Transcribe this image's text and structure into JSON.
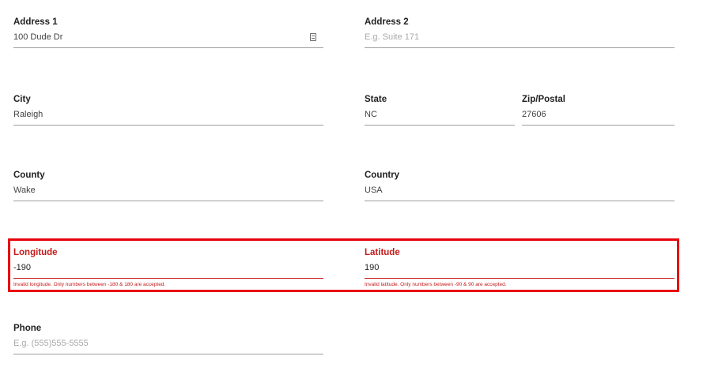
{
  "address1": {
    "label": "Address 1",
    "value": "100 Dude Dr",
    "icon": "contact-card-icon"
  },
  "address2": {
    "label": "Address 2",
    "placeholder": "E.g. Suite 171"
  },
  "city": {
    "label": "City",
    "value": "Raleigh"
  },
  "state": {
    "label": "State",
    "value": "NC"
  },
  "zip": {
    "label": "Zip/Postal",
    "value": "27606"
  },
  "county": {
    "label": "County",
    "value": "Wake"
  },
  "country": {
    "label": "Country",
    "value": "USA"
  },
  "longitude": {
    "label": "Longitude",
    "value": "-190",
    "error": "Invalid longitude. Only numbers between -180 & 180 are accepted."
  },
  "latitude": {
    "label": "Latitude",
    "value": "190",
    "error": "Invalid latitude. Only numbers between -90 & 90 are accepted."
  },
  "phone": {
    "label": "Phone",
    "placeholder": "E.g. (555)555-5555"
  },
  "colors": {
    "error": "#c41a1a",
    "highlight": "#e8000b",
    "underline": "#9e9e9e",
    "placeholder": "#a8a8a8"
  }
}
